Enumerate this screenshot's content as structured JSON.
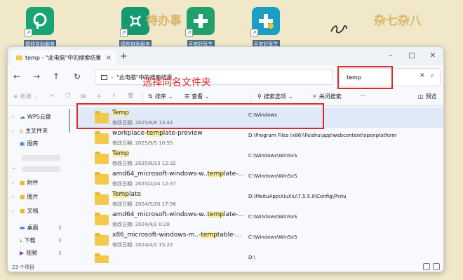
{
  "desktop": {
    "icons": [
      "德邦自助服务",
      "德邦自助服务",
      "平安好医生",
      "平安好医生"
    ],
    "decor": [
      "待办事",
      "杂七杂八"
    ]
  },
  "window": {
    "tab_title": "temp - \"此电脑\"中的搜索结果",
    "address": "\"此电脑\"中的搜索结果",
    "search_value": "temp",
    "toolbar": {
      "new": "新建",
      "sort": "排序",
      "view": "查看",
      "search_options": "搜索选项",
      "close_search": "关闭搜索",
      "preview": "预览"
    },
    "sidebar": {
      "wps": "WPS云盘",
      "home": "主文件夹",
      "gallery": "图库",
      "attachments": "附件",
      "pictures": "图片",
      "documents": "文档",
      "desktop": "桌面",
      "downloads": "下载",
      "videos": "视频"
    },
    "annotation": "选择同名文件夹",
    "status": "23 个项目",
    "files": [
      {
        "pre": "",
        "hl": "Temp",
        "post": "",
        "date": "修改日期: 2025/9/8 13:44",
        "path": "C:\\Windows"
      },
      {
        "pre": "workplace-",
        "hl": "temp",
        "post": "late-preview",
        "date": "修改日期: 2025/9/5 10:55",
        "path": "D:\\Program Files (x86)\\Feishu\\app\\webcontent\\openplatform"
      },
      {
        "pre": "",
        "hl": "Temp",
        "post": "",
        "date": "修改日期: 2025/8/13 12:32",
        "path": "C:\\Windows\\WinSxS"
      },
      {
        "pre": "amd64_microsoft-windows-w..",
        "hl": "temp",
        "post": "late-...",
        "date": "修改日期: 2025/2/24 12:37",
        "path": "C:\\Windows\\WinSxS"
      },
      {
        "pre": "",
        "hl": "Temp",
        "post": "late",
        "date": "修改日期: 2024/5/20 17:56",
        "path": "D:\\MeituApp\\XiuXiu\\7.5.5.0\\Config\\Pintu"
      },
      {
        "pre": "amd64_microsoft-windows-w..",
        "hl": "temp",
        "post": "late-...",
        "date": "修改日期: 2024/4/2 0:28",
        "path": "C:\\Windows\\WinSxS"
      },
      {
        "pre": "x86_microsoft-windows-m..-",
        "hl": "temp",
        "post": "table-...",
        "date": "修改日期: 2024/4/1 15:22",
        "path": "C:\\Windows\\WinSxS"
      },
      {
        "pre": "",
        "hl": "",
        "post": "",
        "date": "",
        "path": "D:\\"
      }
    ]
  }
}
